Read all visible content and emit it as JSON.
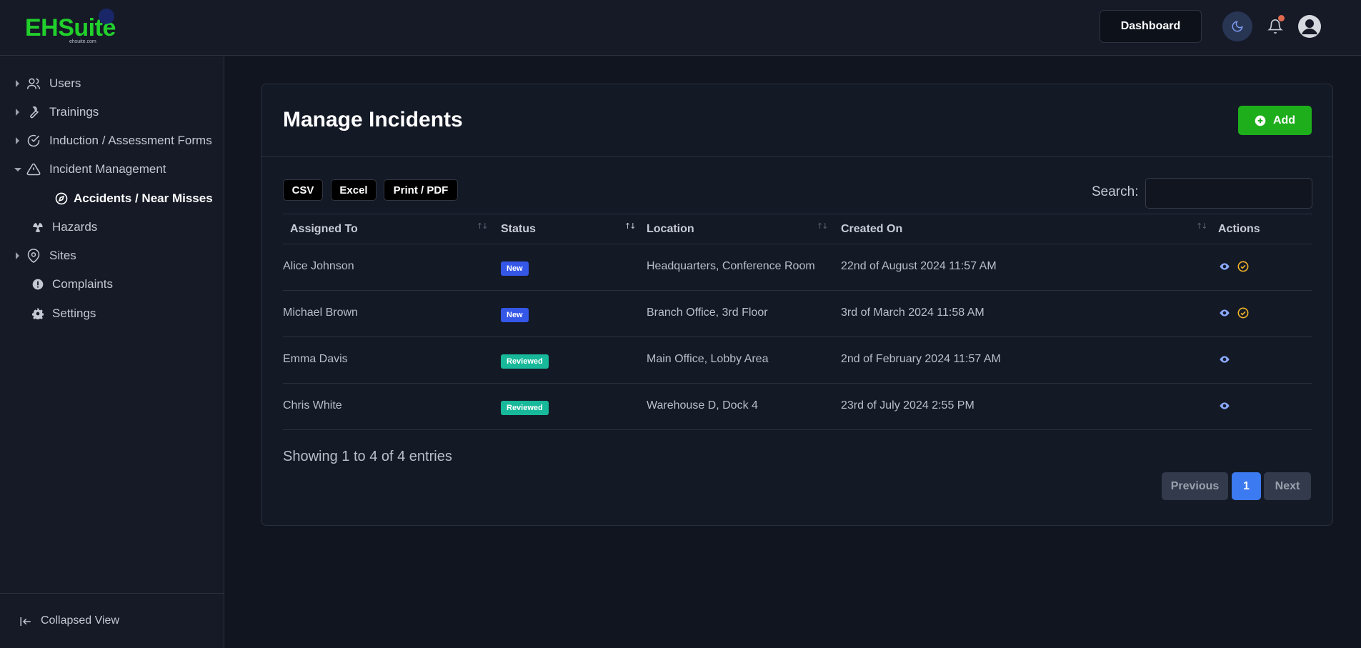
{
  "header": {
    "logo_text": "EHSuite",
    "logo_sub": "ehsuite.com",
    "dashboard_label": "Dashboard"
  },
  "sidebar": {
    "items": [
      {
        "label": "Users",
        "icon": "users-icon"
      },
      {
        "label": "Trainings",
        "icon": "wrench-icon"
      },
      {
        "label": "Induction / Assessment Forms",
        "icon": "check-circle-icon"
      },
      {
        "label": "Incident Management",
        "icon": "warning-icon"
      },
      {
        "label": "Accidents / Near Misses",
        "icon": "compass-icon"
      },
      {
        "label": "Hazards",
        "icon": "radiation-icon"
      },
      {
        "label": "Sites",
        "icon": "map-pin-icon"
      },
      {
        "label": "Complaints",
        "icon": "exclamation-circle-icon"
      },
      {
        "label": "Settings",
        "icon": "gear-icon"
      }
    ],
    "collapse_label": "Collapsed View"
  },
  "page": {
    "title": "Manage Incidents",
    "add_label": "Add",
    "export_buttons": [
      "CSV",
      "Excel",
      "Print / PDF"
    ],
    "search_label": "Search:",
    "search_value": ""
  },
  "table": {
    "columns": [
      "Assigned To",
      "Status",
      "Location",
      "Created On",
      "Actions"
    ],
    "rows": [
      {
        "assigned": "Alice Johnson",
        "status": "New",
        "location": "Headquarters, Conference Room",
        "created": "22nd of August 2024 11:57 AM"
      },
      {
        "assigned": "Michael Brown",
        "status": "New",
        "location": "Branch Office, 3rd Floor",
        "created": "3rd of March 2024 11:58 AM"
      },
      {
        "assigned": "Emma Davis",
        "status": "Reviewed",
        "location": "Main Office, Lobby Area",
        "created": "2nd of February 2024 11:57 AM"
      },
      {
        "assigned": "Chris White",
        "status": "Reviewed",
        "location": "Warehouse D, Dock 4",
        "created": "23rd of July 2024 2:55 PM"
      }
    ],
    "showing": "Showing 1 to 4 of 4 entries"
  },
  "pagination": {
    "previous": "Previous",
    "current": "1",
    "next": "Next"
  },
  "colors": {
    "brand": "#22d02c",
    "add": "#1eae1b",
    "new_badge": "#3557e8",
    "reviewed_badge": "#18b99a",
    "view_icon": "#8aa9ff",
    "approve_icon": "#f0b429"
  }
}
